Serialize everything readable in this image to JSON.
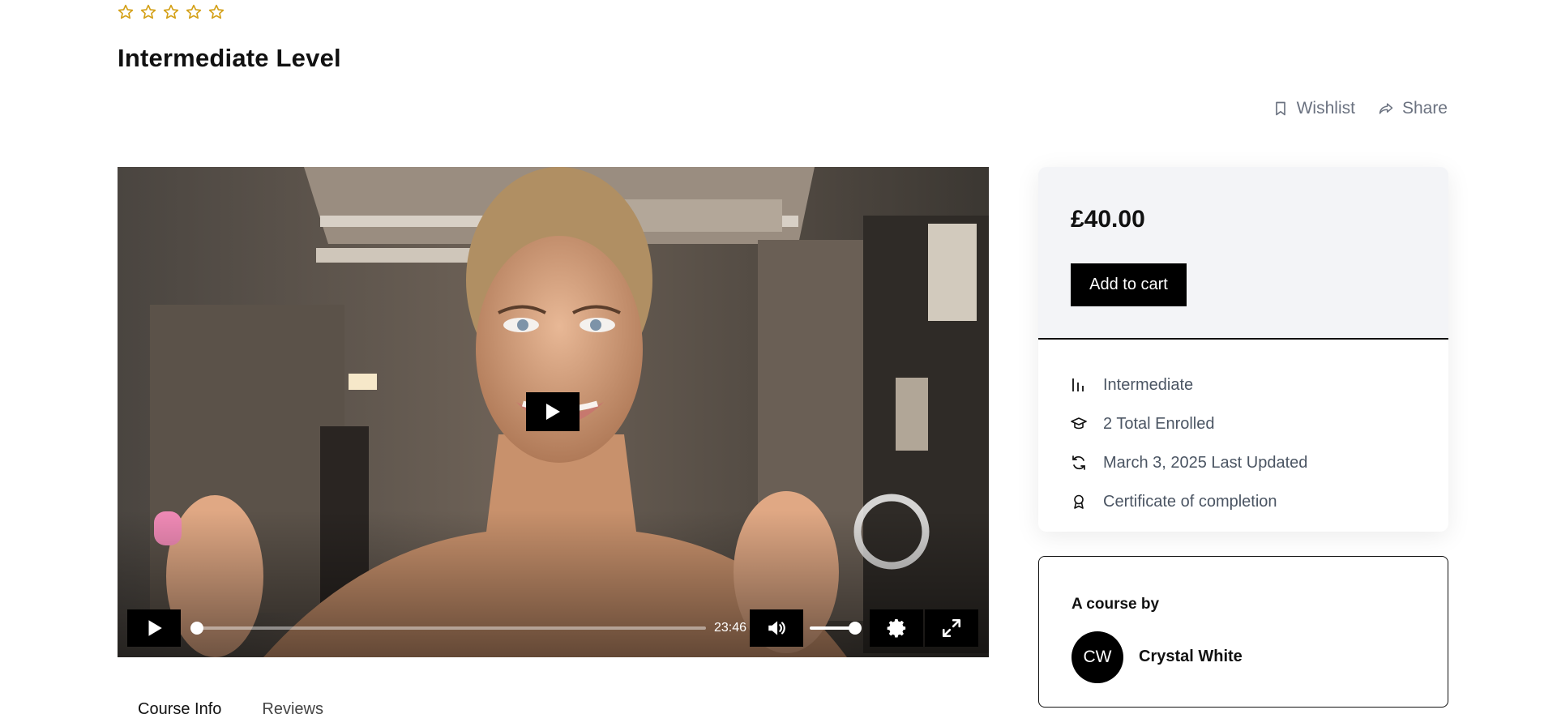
{
  "course": {
    "rating_stars": 5,
    "rating_filled": 0,
    "title": "Intermediate Level"
  },
  "actions": {
    "wishlist_label": "Wishlist",
    "share_label": "Share"
  },
  "video": {
    "duration": "23:46",
    "progress_fraction": 0.0,
    "volume_fraction": 1.0
  },
  "tabs": [
    {
      "label": "Course Info",
      "active": true
    },
    {
      "label": "Reviews",
      "active": false
    }
  ],
  "pricing": {
    "price": "£40.00",
    "add_to_cart_label": "Add to cart",
    "meta": [
      {
        "icon": "level-bars-icon",
        "text": "Intermediate"
      },
      {
        "icon": "graduation-cap-icon",
        "text": "2 Total Enrolled"
      },
      {
        "icon": "refresh-icon",
        "text": "March 3, 2025 Last Updated"
      },
      {
        "icon": "award-icon",
        "text": "Certificate of completion"
      }
    ]
  },
  "instructor": {
    "label": "A course by",
    "initials": "CW",
    "name": "Crystal White"
  },
  "colors": {
    "star": "#d4a017",
    "accent": "#000000",
    "card_bg": "#f3f4f7",
    "muted_text": "#6b7280"
  }
}
